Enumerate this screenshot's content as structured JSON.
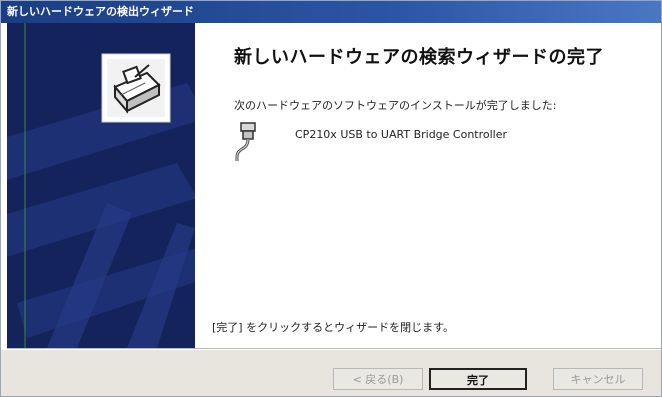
{
  "window": {
    "title": "新しいハードウェアの検出ウィザード"
  },
  "main": {
    "heading": "新しいハードウェアの検索ウィザードの完了",
    "installed_message": "次のハードウェアのソフトウェアのインストールが完了しました:",
    "device_name": "CP210x USB to UART Bridge Controller",
    "close_hint": "[完了] をクリックするとウィザードを閉じます。"
  },
  "buttons": {
    "back": "< 戻る(B)",
    "finish": "完了",
    "cancel": "キャンセル"
  },
  "colors": {
    "titlebar": "#2b56a6",
    "side_panel": "#14235c"
  },
  "icons": {
    "wizard_hardware": "hardware-wizard-icon",
    "device": "usb-cable-icon"
  }
}
